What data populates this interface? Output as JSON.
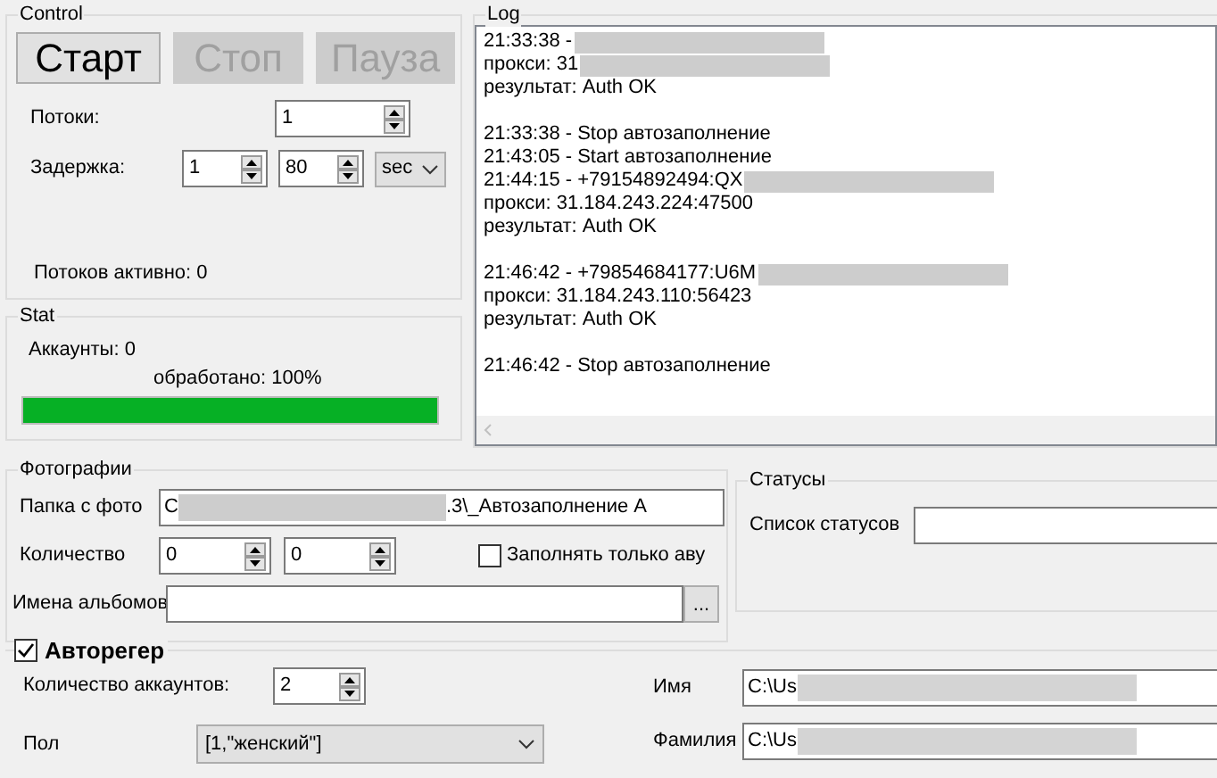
{
  "control": {
    "title": "Control",
    "buttons": [
      {
        "label": "Старт",
        "disabled": false
      },
      {
        "label": "Стоп",
        "disabled": true
      },
      {
        "label": "Пауза",
        "disabled": true
      }
    ],
    "threads": {
      "label": "Потоки:",
      "value": "1"
    },
    "delay": {
      "label": "Задержка:",
      "min": "1",
      "max": "80",
      "unit": "sec"
    },
    "active_threads": "Потоков активно: 0"
  },
  "stat": {
    "title": "Stat",
    "accounts": "Аккаунты: 0",
    "processed": "обработано: 100%",
    "progress": {
      "level": 1
    }
  },
  "log": {
    "title": "Log",
    "blocks": [
      [
        {
          "text": "21:33:38 -",
          "redacted": true
        },
        {
          "text": "прокси: 31",
          "redacted": true
        },
        {
          "text": "результат: Auth OK",
          "redacted": false
        }
      ],
      [
        {
          "text": "21:33:38 - Stop автозаполнение",
          "redacted": false
        },
        {
          "text": "21:43:05 - Start автозаполнение",
          "redacted": false
        },
        {
          "text": "21:44:15 - +79154892494:QX",
          "redacted": true
        },
        {
          "text": "прокси: 31.184.243.224:47500",
          "redacted": false
        },
        {
          "text": "результат: Auth OK",
          "redacted": false
        }
      ],
      [
        {
          "text": "21:46:42 - +79854684177:U6M",
          "redacted": true
        },
        {
          "text": "прокси: 31.184.243.110:56423",
          "redacted": false
        },
        {
          "text": "результат: Auth OK",
          "redacted": false
        }
      ],
      [
        {
          "text": "21:46:42 - Stop автозаполнение",
          "redacted": false
        }
      ]
    ]
  },
  "photos": {
    "title": "Фотографии",
    "folder": {
      "label": "Папка с фото",
      "value_start": "C",
      "value_end": ".3\\_Автозаполнение А"
    },
    "count": {
      "label": "Количество",
      "values": [
        "0",
        "0"
      ]
    },
    "only_avatar": {
      "label": "Заполнять только аву",
      "checked": false
    },
    "albums": {
      "label": "Имена альбомов",
      "browse": "..."
    }
  },
  "statuses": {
    "title": "Статусы",
    "list_label": "Список статусов"
  },
  "autoreg": {
    "title": "Авторегер",
    "checked": true,
    "accounts": {
      "label": "Количество аккаунтов:",
      "value": "2"
    },
    "gender": {
      "label": "Пол",
      "value": "[1,\"женский\"]"
    },
    "first_name": {
      "label": "Имя",
      "value": "C:\\Us"
    },
    "last_name": {
      "label": "Фамилия",
      "value": "C:\\Us"
    }
  }
}
